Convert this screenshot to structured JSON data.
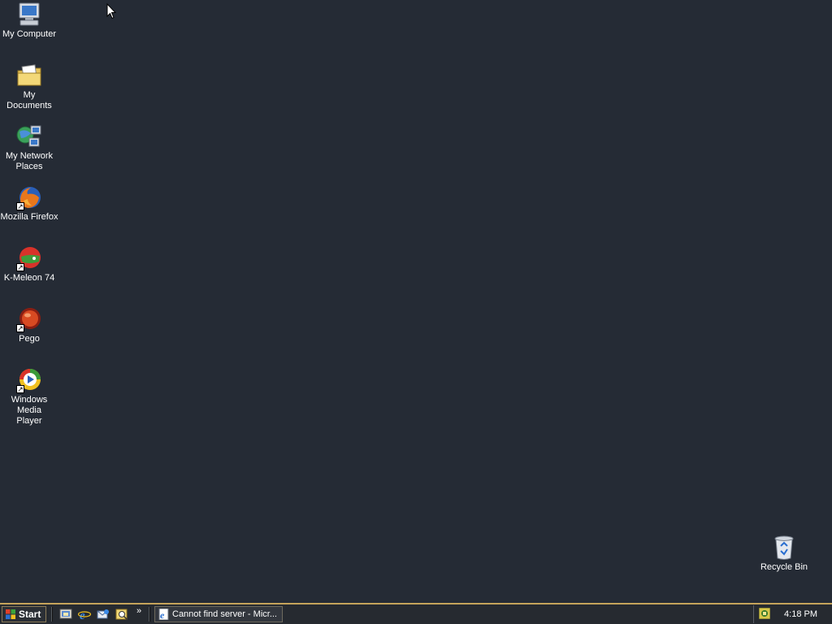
{
  "desktop": {
    "icons": [
      {
        "label": "My Computer",
        "icon": "my-computer-icon",
        "shortcut": false
      },
      {
        "label": "My Documents",
        "icon": "my-documents-icon",
        "shortcut": false
      },
      {
        "label": "My Network Places",
        "icon": "network-places-icon",
        "shortcut": false
      },
      {
        "label": "Mozilla Firefox",
        "icon": "firefox-icon",
        "shortcut": true
      },
      {
        "label": "K-Meleon 74",
        "icon": "k-meleon-icon",
        "shortcut": true
      },
      {
        "label": "Pego",
        "icon": "pego-icon",
        "shortcut": true
      },
      {
        "label": "Windows Media Player",
        "icon": "windows-media-player-icon",
        "shortcut": true
      }
    ],
    "recycle_bin": {
      "label": "Recycle Bin",
      "icon": "recycle-bin-icon"
    },
    "background_color": "#252b35"
  },
  "taskbar": {
    "start_label": "Start",
    "quick_launch": [
      "show-desktop-icon",
      "internet-explorer-icon",
      "outlook-express-icon",
      "search-icon"
    ],
    "overflow_label": "»",
    "task_button": {
      "label": "Cannot find server - Micr...",
      "icon": "internet-explorer-page-icon"
    },
    "tray_icon": "tray-app-icon",
    "clock": "4:18 PM",
    "accent_color": "#c5a35a"
  }
}
